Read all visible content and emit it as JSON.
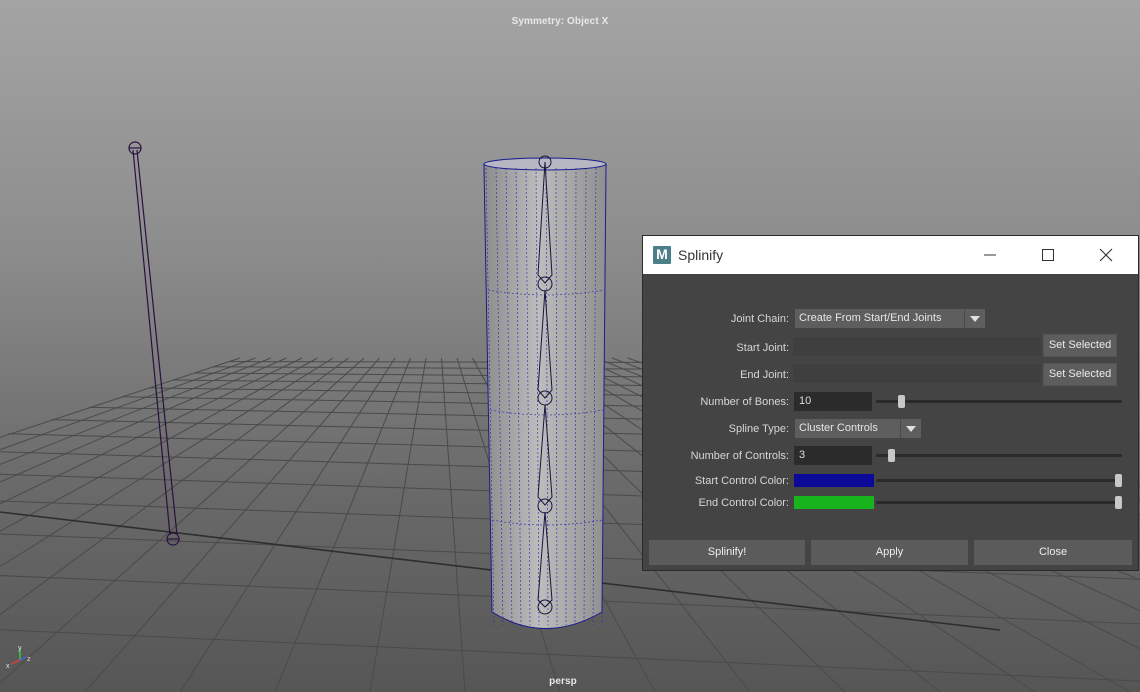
{
  "viewport": {
    "symmetry_label": "Symmetry: Object X",
    "camera_label": "persp",
    "axis_labels": {
      "x": "x",
      "y": "y",
      "z": "z"
    }
  },
  "dialog": {
    "icon_label": "M",
    "title": "Splinify",
    "joint_chain": {
      "label": "Joint Chain:",
      "value": "Create From Start/End Joints"
    },
    "start_joint": {
      "label": "Start Joint:",
      "value": "",
      "button": "Set Selected"
    },
    "end_joint": {
      "label": "End Joint:",
      "value": "",
      "button": "Set Selected"
    },
    "num_bones": {
      "label": "Number of Bones:",
      "value": "10",
      "slider_fraction": 0.09
    },
    "spline_type": {
      "label": "Spline Type:",
      "value": "Cluster Controls"
    },
    "num_controls": {
      "label": "Number of Controls:",
      "value": "3",
      "slider_fraction": 0.05
    },
    "start_color": {
      "label": "Start Control Color:",
      "color": "#0a0a96",
      "slider_fraction": 1.0
    },
    "end_color": {
      "label": "End Control Color:",
      "color": "#18b41e",
      "slider_fraction": 1.0
    },
    "buttons": {
      "splinify": "Splinify!",
      "apply": "Apply",
      "close": "Close"
    }
  }
}
